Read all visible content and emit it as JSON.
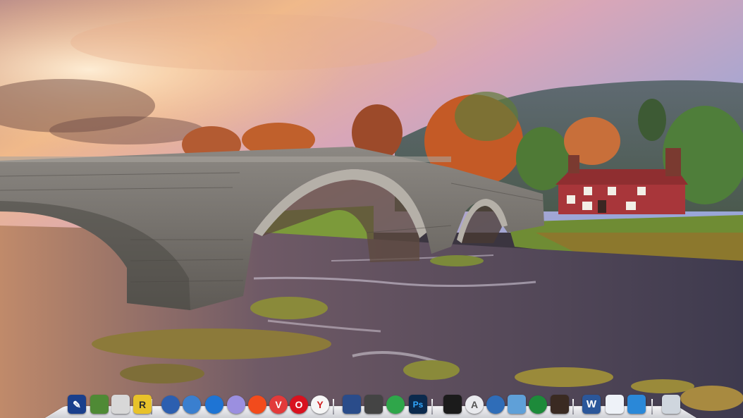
{
  "screen": {
    "kind": "desktop",
    "wallpaper": "stone arch bridge over river with cottage in autumn"
  },
  "colors": {
    "sky_top": "#9aa0c8",
    "sky_sunset": "#f2b889",
    "river": "#4d4455",
    "bridge_stone": "#7a7670",
    "foliage_orange": "#c4582a",
    "grass": "#7c9a3a",
    "cottage_red": "#a8363a",
    "dock_shelf": "#e6e6ea"
  },
  "dock": {
    "items": [
      {
        "name": "desktop-utility",
        "icon": "monitor-icon",
        "glyph": "✎",
        "bg": "#1a3f8c"
      },
      {
        "name": "cactus-app",
        "icon": "cactus-icon",
        "glyph": "",
        "bg": "#4f8a35"
      },
      {
        "name": "preview",
        "icon": "photos-icon",
        "glyph": "",
        "bg": "#d8d8d8"
      },
      {
        "name": "r-app",
        "icon": "r-letter-icon",
        "glyph": "R",
        "bg": "#e8c22a"
      },
      {
        "name": "firefox",
        "icon": "firefox-icon",
        "glyph": "",
        "bg": "#2c5fb0"
      },
      {
        "name": "browser-globe",
        "icon": "globe-icon",
        "glyph": "",
        "bg": "#3a7fcf"
      },
      {
        "name": "safari",
        "icon": "compass-icon",
        "glyph": "",
        "bg": "#1e74d4"
      },
      {
        "name": "web-browser",
        "icon": "sphere-icon",
        "glyph": "",
        "bg": "#9b8fe0"
      },
      {
        "name": "brave",
        "icon": "lion-icon",
        "glyph": "",
        "bg": "#f24b1c"
      },
      {
        "name": "vivaldi",
        "icon": "v-icon",
        "glyph": "V",
        "bg": "#e23b3b"
      },
      {
        "name": "opera",
        "icon": "o-icon",
        "glyph": "O",
        "bg": "#d8121f"
      },
      {
        "name": "yandex",
        "icon": "y-icon",
        "glyph": "Y",
        "bg": "#f6f6f6"
      },
      {
        "name": "save-tool",
        "icon": "floppy-disk-icon",
        "glyph": "",
        "bg": "#2a4c8a"
      },
      {
        "name": "camera",
        "icon": "camera-icon",
        "glyph": "",
        "bg": "#444"
      },
      {
        "name": "internet",
        "icon": "green-orb-icon",
        "glyph": "",
        "bg": "#2fa64a"
      },
      {
        "name": "photoshop",
        "icon": "ps-icon",
        "glyph": "Ps",
        "bg": "#0b2a4d"
      },
      {
        "name": "final-cut",
        "icon": "clapper-icon",
        "glyph": "",
        "bg": "#1b1b1b"
      },
      {
        "name": "app-store",
        "icon": "app-store-icon",
        "glyph": "A",
        "bg": "#e9eaee"
      },
      {
        "name": "world",
        "icon": "earth-icon",
        "glyph": "",
        "bg": "#2f6db8"
      },
      {
        "name": "pen-tool",
        "icon": "pencil-icon",
        "glyph": "",
        "bg": "#5fa0d8"
      },
      {
        "name": "jamaica",
        "icon": "flag-orb-icon",
        "glyph": "",
        "bg": "#1d8a3a"
      },
      {
        "name": "photo-booth",
        "icon": "photo-booth-icon",
        "glyph": "",
        "bg": "#3a2a22"
      },
      {
        "name": "word",
        "icon": "word-icon",
        "glyph": "W",
        "bg": "#2b579a"
      },
      {
        "name": "pages",
        "icon": "document-icon",
        "glyph": "",
        "bg": "#eef2f8"
      },
      {
        "name": "mail",
        "icon": "envelope-icon",
        "glyph": "",
        "bg": "#2a88d8"
      },
      {
        "name": "trash",
        "icon": "trash-icon",
        "glyph": "",
        "bg": "#cfd6de"
      }
    ]
  }
}
